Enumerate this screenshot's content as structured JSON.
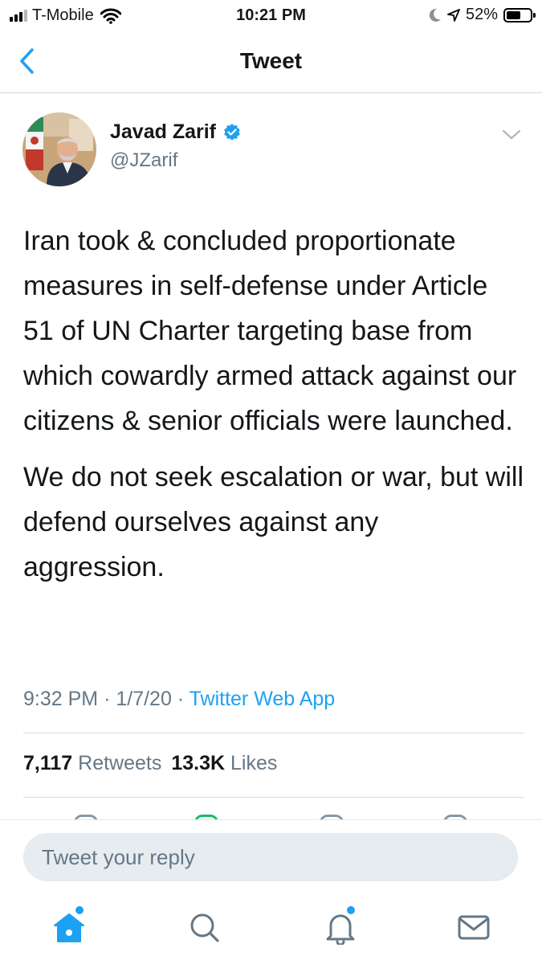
{
  "status_bar": {
    "carrier": "T-Mobile",
    "time": "10:21 PM",
    "battery": "52%",
    "battery_level": 0.52
  },
  "nav": {
    "title": "Tweet"
  },
  "author": {
    "name": "Javad Zarif",
    "handle": "@JZarif",
    "verified": true
  },
  "tweet": {
    "paragraph1": "Iran took & concluded proportionate measures in self-defense under Article 51 of UN Charter targeting base from which cowardly armed attack against our citizens & senior officials were launched.",
    "paragraph2": "We do not seek escalation or war, but will defend ourselves against any aggression.",
    "time": "9:32 PM",
    "date": "1/7/20",
    "source": "Twitter Web App",
    "separator": "·"
  },
  "stats": {
    "retweets_count": "7,117",
    "retweets_label": "Retweets",
    "likes_count": "13.3K",
    "likes_label": "Likes"
  },
  "reply": {
    "placeholder": "Tweet your reply"
  },
  "colors": {
    "accent": "#1da1f2",
    "muted": "#657786",
    "text": "#14171a"
  },
  "tabs": [
    {
      "icon": "home-icon",
      "active": true,
      "badge": true
    },
    {
      "icon": "search-icon",
      "active": false,
      "badge": false
    },
    {
      "icon": "notifications-icon",
      "active": false,
      "badge": true
    },
    {
      "icon": "messages-icon",
      "active": false,
      "badge": false
    }
  ]
}
